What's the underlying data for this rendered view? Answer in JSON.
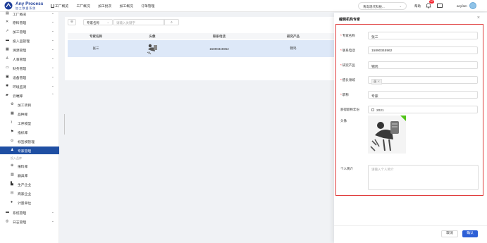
{
  "brand": {
    "name": "Any Process",
    "subtitle": "加 工 数 据 系 统"
  },
  "top_nav": [
    "工厂概览",
    "工厂概况",
    "加工批次",
    "加工概况",
    "订单管理"
  ],
  "env_select": "青岛现代科技...",
  "help_label": "帮助",
  "notification_count": "10",
  "username": "anyfam",
  "sidebar": {
    "items": [
      {
        "label": "工厂概况",
        "icon": "factory-icon",
        "arrow": "⌄"
      },
      {
        "label": "原料管理",
        "icon": "tools-icon",
        "arrow": "⌄"
      },
      {
        "label": "加工管理",
        "icon": "wrench-icon",
        "arrow": "⌄"
      },
      {
        "label": "投入品管理",
        "icon": "truck-icon",
        "arrow": "⌄"
      },
      {
        "label": "溯源管理",
        "icon": "trace-icon",
        "arrow": "⌄"
      },
      {
        "label": "人事管理",
        "icon": "person-icon",
        "arrow": "⌄"
      },
      {
        "label": "财务管理",
        "icon": "finance-icon",
        "arrow": "⌄"
      },
      {
        "label": "设备管理",
        "icon": "device-icon",
        "arrow": "⌄"
      },
      {
        "label": "环境监测",
        "icon": "environment-icon",
        "arrow": "⌄"
      },
      {
        "label": "云端库",
        "icon": "cloud-library-icon",
        "arrow": "⌃"
      },
      {
        "label": "加工项目",
        "icon": "project-icon"
      },
      {
        "label": "品种库",
        "icon": "variety-icon"
      },
      {
        "label": "工序模型",
        "icon": "process-model-icon"
      },
      {
        "label": "指标库",
        "icon": "indicator-icon"
      },
      {
        "label": "标签模管理",
        "icon": "label-icon"
      },
      {
        "label": "专家管理",
        "icon": "expert-icon"
      },
      {
        "label": "报料库",
        "icon": "material-icon"
      },
      {
        "label": "器具库",
        "icon": "equipment-icon"
      },
      {
        "label": "生产企业",
        "icon": "enterprise-icon"
      },
      {
        "label": "商家企业",
        "icon": "merchant-icon"
      },
      {
        "label": "计量单位",
        "icon": "location-icon"
      },
      {
        "label": "系统管理",
        "icon": "system-icon",
        "arrow": "⌄"
      },
      {
        "label": "日志管理",
        "icon": "log-icon",
        "arrow": "⌄"
      }
    ],
    "group_label": "投入品库"
  },
  "toolbar": {
    "refresh_icon": "⊕",
    "field_select": "专家名称",
    "search_placeholder": "请输入关键字",
    "search_icon": "⌕"
  },
  "table": {
    "columns": [
      "专家名称",
      "头像",
      "联系电话",
      "研究产品",
      "擅长领域"
    ],
    "rows": [
      {
        "name": "张三",
        "phone": "15890345962",
        "product": "锦鸡",
        "field": "蛋"
      }
    ]
  },
  "drawer": {
    "title": "编辑机构专家",
    "close": "×",
    "fields": {
      "name_label": "专家名称",
      "name_value": "张三",
      "phone_label": "联系电话",
      "phone_value": "15890345962",
      "product_label": "研究产品",
      "product_value": "锦鸡",
      "field_label": "擅长领域",
      "field_tag": "蛋",
      "title_label": "职称",
      "title_value": "专家",
      "year_label": "获得职称年份",
      "year_value": "2021",
      "avatar_label": "头像",
      "intro_label": "个人简介",
      "intro_placeholder": "请输入个人简介"
    },
    "cancel": "取消",
    "confirm": "确认"
  },
  "colors": {
    "accent": "#1f4fa3",
    "primary_button": "#2d5fd6",
    "highlight_border": "#e03c3c",
    "selected_row": "#dde8f8"
  }
}
